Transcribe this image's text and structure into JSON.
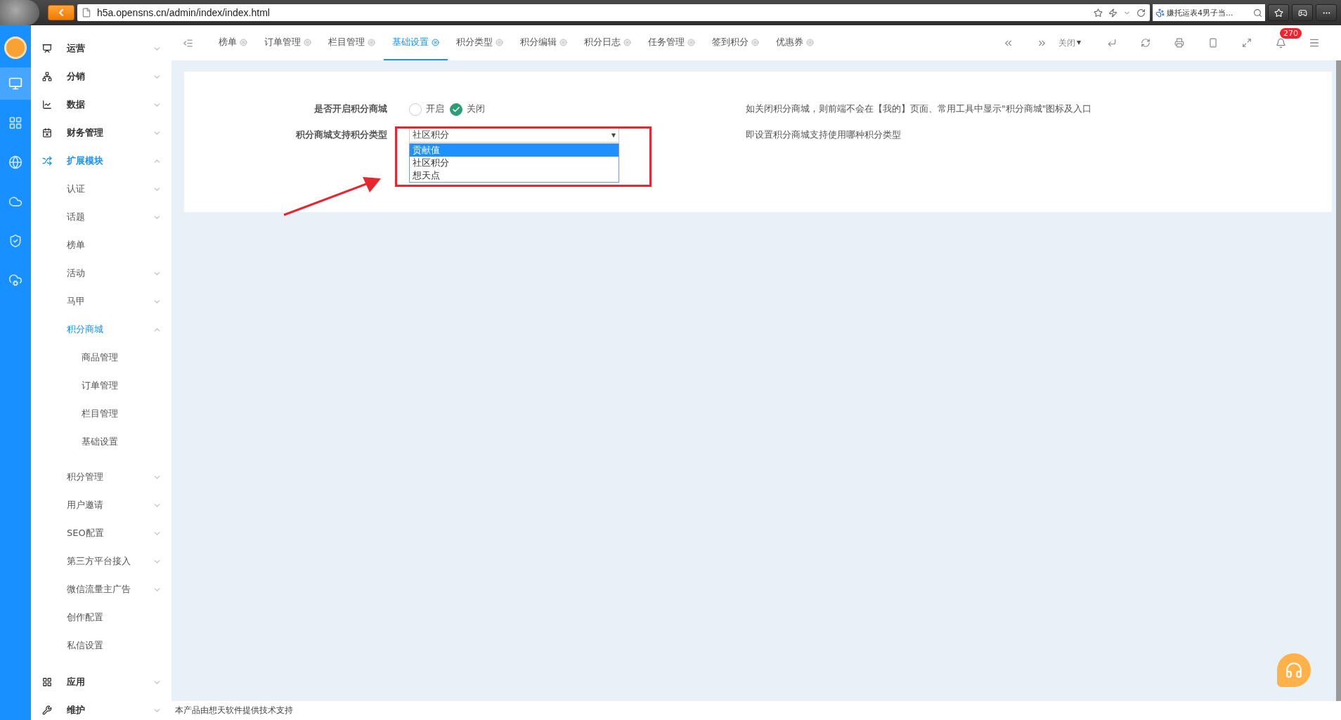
{
  "browser": {
    "url": "h5a.opensns.cn/admin/index/index.html",
    "search": "嫌托运表4男子当..."
  },
  "rail": [
    {
      "selected": true
    },
    {
      "selected": false
    },
    {
      "selected": false
    },
    {
      "selected": false
    },
    {
      "selected": false
    },
    {
      "selected": false
    }
  ],
  "sidebar": {
    "items": [
      {
        "label": "运营",
        "kind": "folder",
        "expanded": false
      },
      {
        "label": "分销",
        "kind": "folder",
        "expanded": false
      },
      {
        "label": "数据",
        "kind": "folder",
        "expanded": false
      },
      {
        "label": "财务管理",
        "kind": "folder",
        "expanded": false
      },
      {
        "label": "扩展模块",
        "kind": "folder",
        "expanded": true,
        "children": [
          {
            "label": "认证",
            "kind": "folder",
            "expanded": false
          },
          {
            "label": "话题",
            "kind": "folder",
            "expanded": false
          },
          {
            "label": "榜单",
            "kind": "leaf"
          },
          {
            "label": "活动",
            "kind": "folder",
            "expanded": false
          },
          {
            "label": "马甲",
            "kind": "folder",
            "expanded": false
          },
          {
            "label": "积分商城",
            "kind": "folder",
            "expanded": true,
            "children": [
              {
                "label": "商品管理"
              },
              {
                "label": "订单管理"
              },
              {
                "label": "栏目管理"
              },
              {
                "label": "基础设置"
              }
            ]
          },
          {
            "label": "积分管理",
            "kind": "folder",
            "expanded": false
          },
          {
            "label": "用户邀请",
            "kind": "folder",
            "expanded": false
          },
          {
            "label": "SEO配置",
            "kind": "folder",
            "expanded": false
          },
          {
            "label": "第三方平台接入",
            "kind": "folder",
            "expanded": false
          },
          {
            "label": "微信流量主广告",
            "kind": "folder",
            "expanded": false
          },
          {
            "label": "创作配置",
            "kind": "leaf"
          },
          {
            "label": "私信设置",
            "kind": "leaf"
          }
        ]
      },
      {
        "label": "应用",
        "kind": "folder",
        "expanded": false
      },
      {
        "label": "维护",
        "kind": "folder",
        "expanded": false
      }
    ]
  },
  "tabs": [
    {
      "label": "榜单",
      "selected": false
    },
    {
      "label": "订单管理",
      "selected": false
    },
    {
      "label": "栏目管理",
      "selected": false
    },
    {
      "label": "基础设置",
      "selected": true
    },
    {
      "label": "积分类型",
      "selected": false
    },
    {
      "label": "积分编辑",
      "selected": false
    },
    {
      "label": "积分日志",
      "selected": false
    },
    {
      "label": "任务管理",
      "selected": false
    },
    {
      "label": "签到积分",
      "selected": false
    },
    {
      "label": "优惠券",
      "selected": false
    }
  ],
  "toolbar": {
    "close_label": "关闭",
    "notification_count": "270"
  },
  "form": {
    "rows": [
      {
        "kind": "radio",
        "label": "是否开启积分商城",
        "options": [
          {
            "label": "开启",
            "selected": false
          },
          {
            "label": "关闭",
            "selected": true
          }
        ],
        "hint": "如关闭积分商城，则前端不会在【我的】页面、常用工具中显示\"积分商城\"图标及入口"
      },
      {
        "kind": "select",
        "label": "积分商城支持积分类型",
        "value": "社区积分",
        "expanded": true,
        "options": [
          {
            "label": "贡献值",
            "highlighted": true
          },
          {
            "label": "社区积分",
            "highlighted": false
          },
          {
            "label": "想天点",
            "highlighted": false
          }
        ],
        "hint": "即设置积分商城支持使用哪种积分类型"
      }
    ]
  },
  "footer": "本产品由想天软件提供技术支持"
}
